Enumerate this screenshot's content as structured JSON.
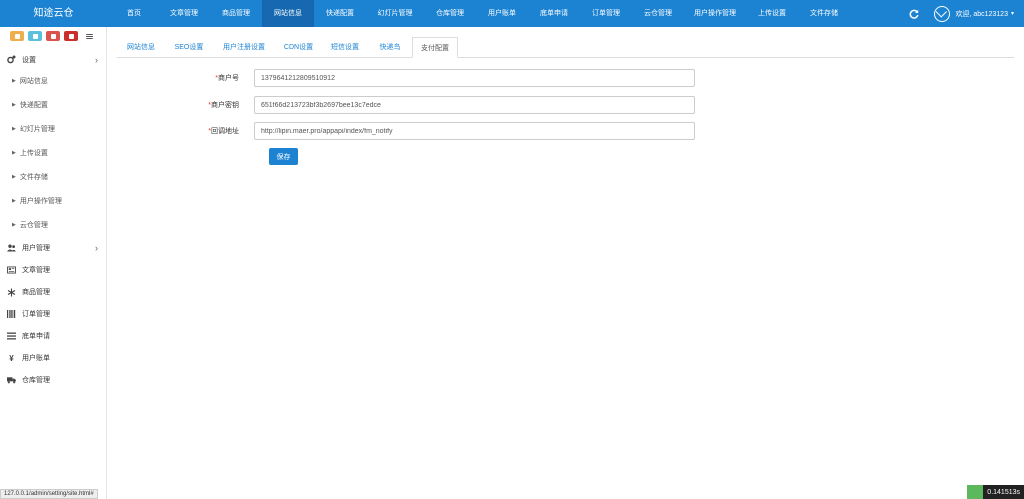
{
  "app": {
    "logo": "知途云仓"
  },
  "topnav": [
    {
      "label": "首页"
    },
    {
      "label": "文章管理"
    },
    {
      "label": "商品管理"
    },
    {
      "label": "网站信息"
    },
    {
      "label": "快递配置"
    },
    {
      "label": "幻灯片管理"
    },
    {
      "label": "仓库管理"
    },
    {
      "label": "用户账单"
    },
    {
      "label": "底单申请"
    },
    {
      "label": "订单管理"
    },
    {
      "label": "云仓管理"
    },
    {
      "label": "用户操作管理"
    },
    {
      "label": "上传设置"
    },
    {
      "label": "文件存储"
    }
  ],
  "topnav_active_index": 3,
  "user": {
    "greeting": "欢迎, abc123123",
    "caret": "▾"
  },
  "sidebar": {
    "settings": {
      "label": "设置",
      "arrow": "›"
    },
    "settings_children": [
      {
        "label": "网站信息"
      },
      {
        "label": "快递配置"
      },
      {
        "label": "幻灯片管理"
      },
      {
        "label": "上传设置"
      },
      {
        "label": "文件存储"
      },
      {
        "label": "用户操作管理"
      },
      {
        "label": "云仓管理"
      }
    ],
    "items": [
      {
        "label": "用户管理",
        "icon": "users-icon",
        "arrow": "›"
      },
      {
        "label": "文章管理",
        "icon": "newspaper-icon",
        "arrow": ""
      },
      {
        "label": "商品管理",
        "icon": "snowflake-icon",
        "arrow": ""
      },
      {
        "label": "订单管理",
        "icon": "barcode-icon",
        "arrow": ""
      },
      {
        "label": "底单申请",
        "icon": "bars-icon",
        "arrow": ""
      },
      {
        "label": "用户账单",
        "icon": "yen-icon",
        "arrow": ""
      },
      {
        "label": "仓库管理",
        "icon": "truck-icon",
        "arrow": ""
      }
    ]
  },
  "tabs": [
    {
      "label": "网站信息"
    },
    {
      "label": "SEO设置"
    },
    {
      "label": "用户注册设置"
    },
    {
      "label": "CDN设置"
    },
    {
      "label": "短信设置"
    },
    {
      "label": "快递鸟"
    },
    {
      "label": "支付配置"
    }
  ],
  "tabs_active_index": 6,
  "form": {
    "merchant_id": {
      "label": "商户号",
      "value": "1379641212809510912"
    },
    "merchant_key": {
      "label": "商户密钥",
      "value": "651f66d213723bf3b2697bee13c7edce"
    },
    "callback_url": {
      "label": "回调地址",
      "value": "http://lipin.maer.pro/appapi/index/fm_notify"
    },
    "required_mark": "*",
    "save_label": "保存"
  },
  "status": {
    "url": "127.0.0.1/admin/setting/site.html#",
    "timer": "0.141513s"
  },
  "colors": {
    "brand": "#1c83d3",
    "brand_dark": "#1669b0",
    "required": "#ee3333"
  }
}
